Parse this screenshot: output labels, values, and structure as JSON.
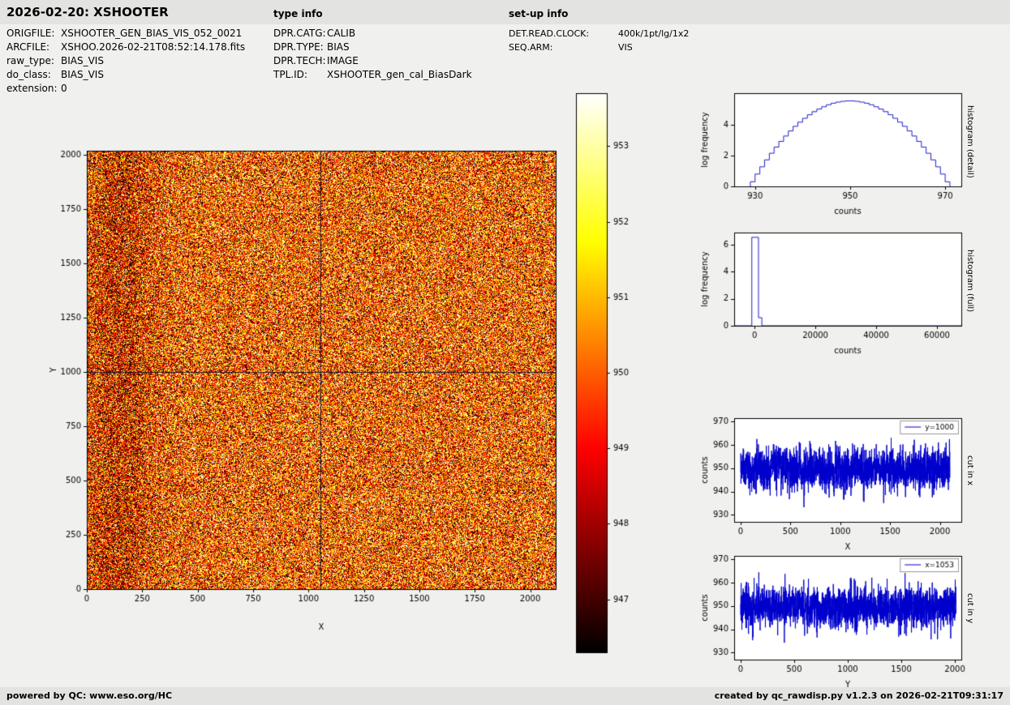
{
  "header": {
    "title": "2026-02-20: XSHOOTER",
    "type_info_label": "type info",
    "setup_info_label": "set-up info"
  },
  "metadata": {
    "left": [
      {
        "label": "ORIGFILE:",
        "value": "XSHOOTER_GEN_BIAS_VIS_052_0021"
      },
      {
        "label": "ARCFILE:",
        "value": "XSHOO.2026-02-21T08:52:14.178.fits"
      },
      {
        "label": "raw_type:",
        "value": "BIAS_VIS"
      },
      {
        "label": "do_class:",
        "value": "BIAS_VIS"
      },
      {
        "label": "extension:",
        "value": "0"
      }
    ],
    "type_info": [
      {
        "label": "DPR.CATG:",
        "value": "CALIB"
      },
      {
        "label": "DPR.TYPE:",
        "value": "BIAS"
      },
      {
        "label": "DPR.TECH:",
        "value": "IMAGE"
      },
      {
        "label": "TPL.ID:",
        "value": "XSHOOTER_gen_cal_BiasDark"
      }
    ],
    "setup_info": [
      {
        "label": "DET.READ.CLOCK:",
        "value": "400k/1pt/lg/1x2"
      },
      {
        "label": "SEQ.ARM:",
        "value": "VIS"
      }
    ]
  },
  "footer": {
    "left": "powered by QC: www.eso.org/HC",
    "right": "created by qc_rawdisp.py v1.2.3 on 2026-02-21T09:31:17"
  },
  "chart_data": [
    {
      "id": "main_image",
      "type": "heatmap",
      "xlabel": "X",
      "ylabel": "Y",
      "xlim": [
        0,
        2115
      ],
      "ylim": [
        0,
        2020
      ],
      "xticks": [
        0,
        250,
        500,
        750,
        1000,
        1250,
        1500,
        1750,
        2000
      ],
      "yticks": [
        0,
        250,
        500,
        750,
        1000,
        1250,
        1500,
        1750,
        2000
      ],
      "crosshair": {
        "x": 1053,
        "y": 1000
      },
      "noise": {
        "mean": 950.0,
        "std": 2.3,
        "seed": 12345
      },
      "cmap": "hot",
      "cmap_domain": [
        946.3,
        953.7
      ],
      "dark_band": {
        "center": 0.07,
        "sigma": 0.05,
        "amp": -1.0
      },
      "layout": {
        "ml": 52,
        "mt": 36,
        "mr": 15,
        "mb": 68,
        "xlab_dy": 42
      }
    },
    {
      "id": "colorbar",
      "type": "colorbar",
      "cmap": "hot",
      "domain": [
        946.3,
        953.7
      ],
      "ticks": [
        947,
        948,
        949,
        950,
        951,
        952,
        953
      ],
      "layout": {
        "ml": 7,
        "mt": 7,
        "bw": 38,
        "bh": 690
      }
    },
    {
      "id": "hist_detail",
      "type": "line",
      "series_type": "step",
      "bin_width": 1,
      "xlabel": "counts",
      "ylabel": "log frequency",
      "side_label": "histogram (detail)",
      "color": "#2020cc",
      "xlim": [
        925.6,
        973.4
      ],
      "ylim": [
        0,
        6.05
      ],
      "xticks": [
        930,
        950,
        970
      ],
      "yticks": [
        0,
        2,
        4
      ],
      "x": [
        929.5,
        930.5,
        931.5,
        932.5,
        933.5,
        934.5,
        935.5,
        936.5,
        937.5,
        938.5,
        939.5,
        940.5,
        941.5,
        942.5,
        943.5,
        944.5,
        945.5,
        946.5,
        947.5,
        948.5,
        949.5,
        950.5,
        951.5,
        952.5,
        953.5,
        954.5,
        955.5,
        956.5,
        957.5,
        958.5,
        959.5,
        960.5,
        961.5,
        962.5,
        963.5,
        964.5,
        965.5,
        966.5,
        967.5,
        968.5,
        969.5,
        970.5
      ],
      "y": [
        0.3,
        0.8,
        1.27,
        1.72,
        2.15,
        2.55,
        2.92,
        3.27,
        3.6,
        3.9,
        4.17,
        4.42,
        4.65,
        4.85,
        5.02,
        5.17,
        5.3,
        5.4,
        5.47,
        5.52,
        5.55,
        5.55,
        5.52,
        5.47,
        5.4,
        5.3,
        5.17,
        5.02,
        4.85,
        4.65,
        4.42,
        4.17,
        3.9,
        3.6,
        3.27,
        2.92,
        2.55,
        2.15,
        1.72,
        1.27,
        0.8,
        0.3
      ],
      "layout": {
        "ml": 47,
        "mt": 10,
        "mr": 8,
        "mb": 45,
        "xlab_dy": 26
      }
    },
    {
      "id": "hist_full",
      "type": "line",
      "series_type": "poly",
      "xlabel": "counts",
      "ylabel": "log frequency",
      "side_label": "histogram (full)",
      "color": "#2020cc",
      "xlim": [
        -6700,
        68000
      ],
      "ylim": [
        0,
        6.9
      ],
      "xticks": [
        0,
        20000,
        40000,
        60000
      ],
      "yticks": [
        0,
        2,
        4,
        6
      ],
      "points": [
        [
          -6700,
          0
        ],
        [
          -900,
          0
        ],
        [
          -900,
          6.55
        ],
        [
          1300,
          6.55
        ],
        [
          1300,
          0.6
        ],
        [
          2400,
          0.6
        ],
        [
          2400,
          0
        ],
        [
          68000,
          0
        ]
      ],
      "layout": {
        "ml": 47,
        "mt": 10,
        "mr": 8,
        "mb": 45,
        "xlab_dy": 26
      }
    },
    {
      "id": "cut_x",
      "type": "line",
      "series_type": "noise",
      "xlabel": "X",
      "ylabel": "counts",
      "side_label": "cut in x",
      "legend": "y=1000",
      "color": "#0000cc",
      "xlim": [
        -65,
        2215
      ],
      "ylim": [
        927,
        971.5
      ],
      "xticks": [
        0,
        500,
        1000,
        1500,
        2000
      ],
      "yticks": [
        930,
        940,
        950,
        960,
        970
      ],
      "noise": {
        "n": 2100,
        "x_start": 0,
        "x_end": 2100,
        "mean": 949.5,
        "std": 4.5,
        "seed": 777
      },
      "layout": {
        "ml": 47,
        "mt": 10,
        "mr": 8,
        "mb": 40,
        "xlab_dy": 26
      }
    },
    {
      "id": "cut_y",
      "type": "line",
      "series_type": "noise",
      "xlabel": "Y",
      "ylabel": "counts",
      "side_label": "cut in y",
      "legend": "x=1053",
      "color": "#0000cc",
      "xlim": [
        -60,
        2060
      ],
      "ylim": [
        927,
        971.5
      ],
      "xticks": [
        0,
        500,
        1000,
        1500,
        2000
      ],
      "yticks": [
        930,
        940,
        950,
        960,
        970
      ],
      "noise": {
        "n": 2010,
        "x_start": 0,
        "x_end": 2010,
        "mean": 949.5,
        "std": 4.5,
        "seed": 999
      },
      "layout": {
        "ml": 47,
        "mt": 10,
        "mr": 8,
        "mb": 40,
        "xlab_dy": 26
      }
    }
  ]
}
